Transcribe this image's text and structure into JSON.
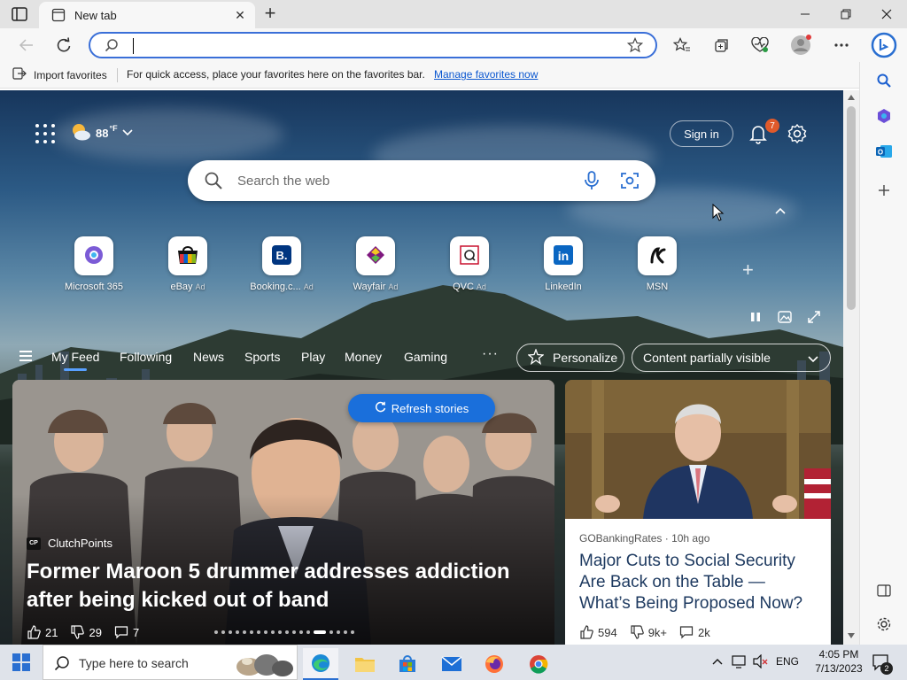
{
  "browser": {
    "tab_title": "New tab",
    "address_value": "",
    "favorites_bar": {
      "import_label": "Import favorites",
      "hint_text": "For quick access, place your favorites here on the favorites bar.",
      "manage_link": "Manage favorites now"
    }
  },
  "newtab": {
    "weather": {
      "temp": "88",
      "unit": "°F"
    },
    "sign_in": "Sign in",
    "notification_count": "7",
    "search_placeholder": "Search the web",
    "quick_links": [
      {
        "label": "Microsoft 365",
        "ad": "",
        "icon": "microsoft-365-icon"
      },
      {
        "label": "eBay",
        "ad": "Ad",
        "icon": "ebay-icon"
      },
      {
        "label": "Booking.c...",
        "ad": "Ad",
        "icon": "booking-icon"
      },
      {
        "label": "Wayfair",
        "ad": "Ad",
        "icon": "wayfair-icon"
      },
      {
        "label": "QVC",
        "ad": "Ad",
        "icon": "qvc-icon"
      },
      {
        "label": "LinkedIn",
        "ad": "",
        "icon": "linkedin-icon"
      },
      {
        "label": "MSN",
        "ad": "",
        "icon": "msn-icon"
      }
    ],
    "feed_tabs": [
      "My Feed",
      "Following",
      "News",
      "Sports",
      "Play",
      "Money",
      "Gaming"
    ],
    "more_label": "···",
    "personalize_label": "Personalize",
    "content_visibility": "Content partially visible",
    "refresh_label": "Refresh stories",
    "main_story": {
      "source_logo": "CP",
      "source": "ClutchPoints",
      "headline": "Former Maroon 5 drummer addresses addiction after being kicked out of band",
      "likes": "21",
      "dislikes": "29",
      "comments": "7"
    },
    "side_story": {
      "source": "GOBankingRates",
      "time": "10h ago",
      "headline": "Major Cuts to Social Security Are Back on the Table — What’s Being Proposed Now?",
      "likes": "594",
      "dislikes": "9k+",
      "comments": "2k"
    }
  },
  "taskbar": {
    "search_placeholder": "Type here to search",
    "language": "ENG",
    "time": "4:05 PM",
    "date": "7/13/2023",
    "notification_count": "2"
  },
  "colors": {
    "accent": "#1a6fdb",
    "omnibox_border": "#3a6fd8",
    "link": "#0b57d0"
  }
}
